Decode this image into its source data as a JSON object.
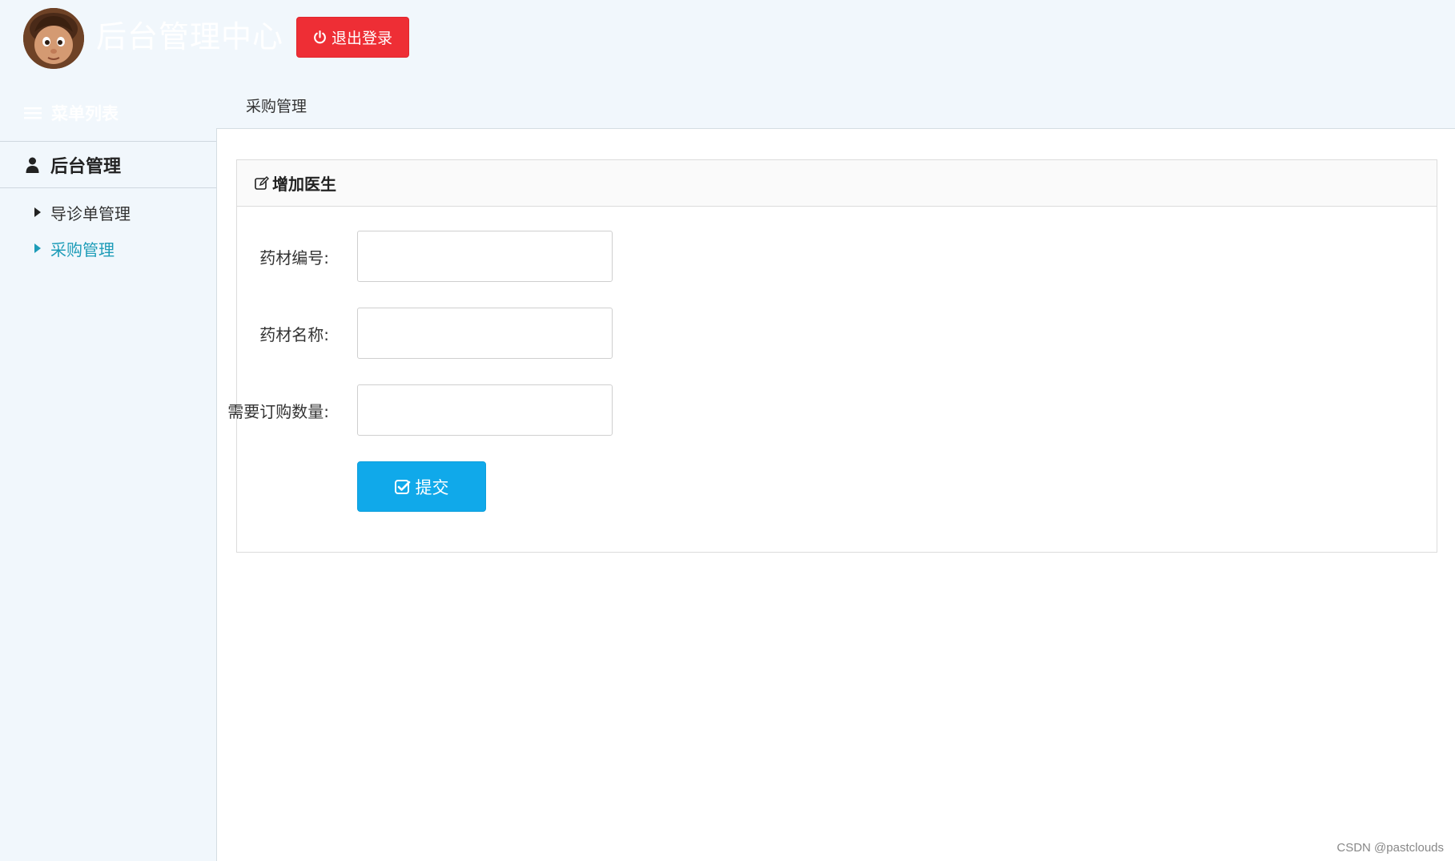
{
  "header": {
    "app_title": "后台管理中心",
    "logout_label": "退出登录"
  },
  "sidebar": {
    "menu_list_title": "菜单列表",
    "group_label": "后台管理",
    "items": [
      {
        "label": "导诊单管理",
        "active": false
      },
      {
        "label": "采购管理",
        "active": true
      }
    ]
  },
  "tabs": [
    {
      "label": "采购管理"
    }
  ],
  "panel": {
    "heading": "增加医生",
    "fields": [
      {
        "label": "药材编号:",
        "value": ""
      },
      {
        "label": "药材名称:",
        "value": ""
      },
      {
        "label": "需要订购数量:",
        "value": ""
      }
    ],
    "submit_label": "提交"
  },
  "watermark": "CSDN @pastclouds",
  "colors": {
    "logout": "#ee2e35",
    "submit": "#10a9ea",
    "active_menu": "#1d9cb8",
    "sidebar_bg": "#f1f7fc"
  }
}
